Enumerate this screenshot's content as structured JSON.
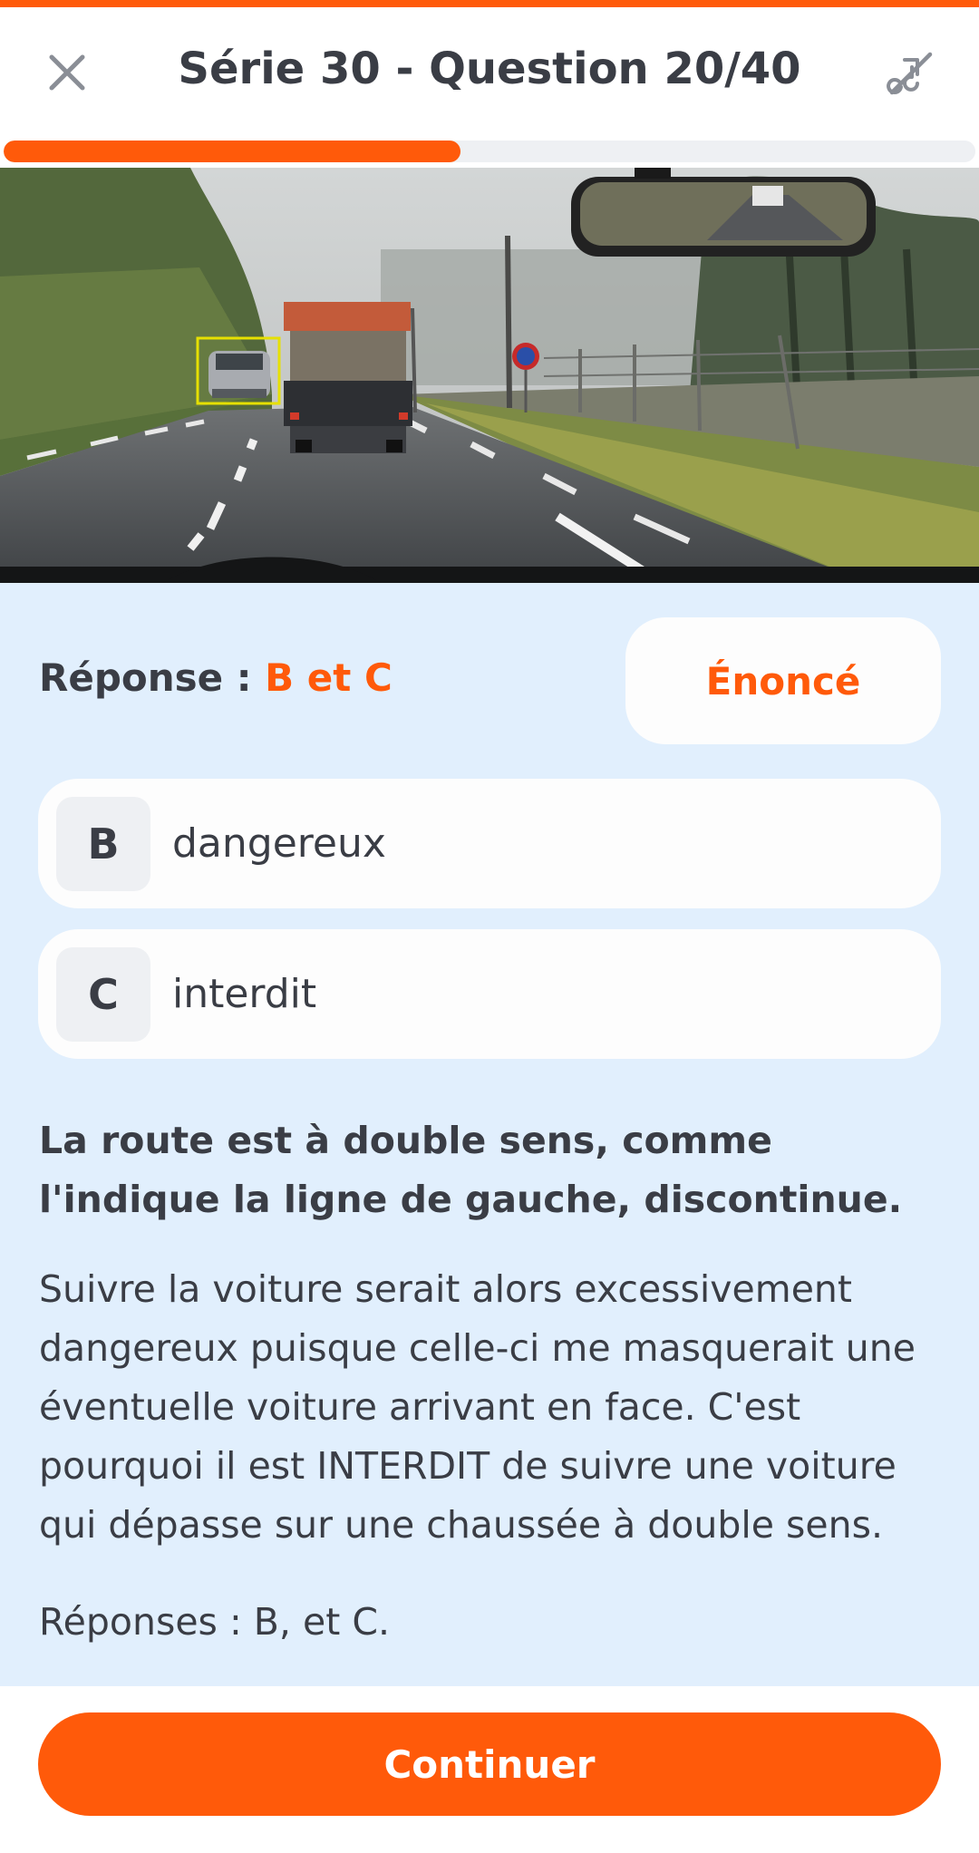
{
  "header": {
    "title": "Série 30 - Question 20/40",
    "close_icon": "close-icon",
    "sound_icon": "sound-off-icon"
  },
  "progress": {
    "current": 20,
    "total": 40,
    "fraction": 0.5
  },
  "scene": {
    "description_icon": "road-scene-photo"
  },
  "answer": {
    "label": "Réponse : ",
    "value": "B et C"
  },
  "enonce_button": "Énoncé",
  "options": [
    {
      "letter": "B",
      "text": "dangereux"
    },
    {
      "letter": "C",
      "text": "interdit"
    }
  ],
  "explanation": {
    "bold": "La route est à double sens, comme l'indique la ligne de gauche, discontinue.",
    "text": "Suivre la voiture serait alors excessivement dangereux puisque celle-ci me masquerait une éventuelle voiture arrivant en face. C'est pourquoi il est INTERDIT de suivre une voiture qui dépasse sur une chaussée à double sens.",
    "summary": "Réponses : B, et C."
  },
  "footer": {
    "continue_label": "Continuer"
  },
  "colors": {
    "accent": "#ff5a0a",
    "panel_bg": "#e1effd",
    "text": "#3a3d45"
  }
}
